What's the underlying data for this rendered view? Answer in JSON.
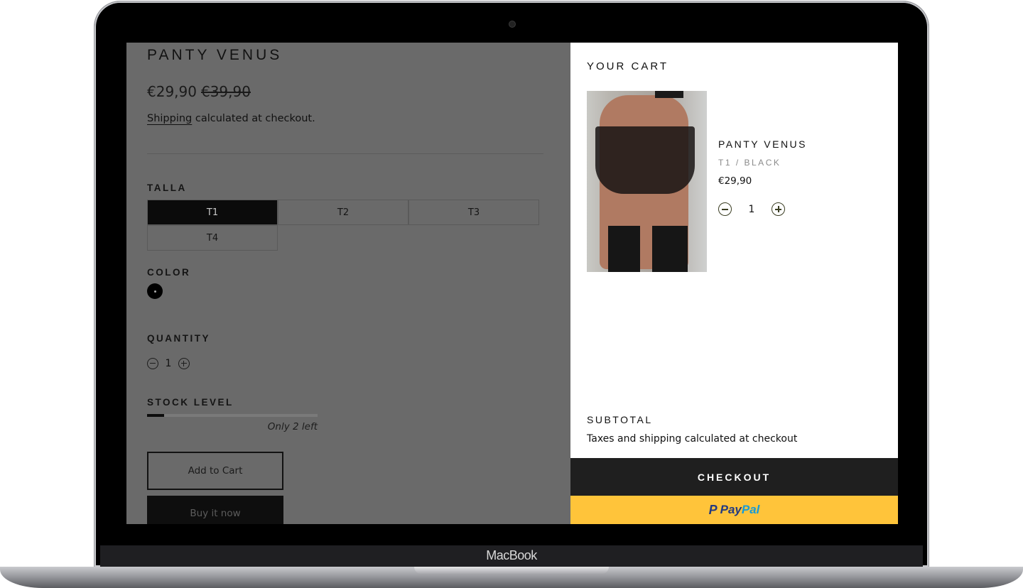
{
  "device": {
    "label": "MacBook"
  },
  "product": {
    "title": "PANTY VENUS",
    "price": "€29,90",
    "compare_price": "€39,90",
    "shipping_link": "Shipping",
    "shipping_text": " calculated at checkout.",
    "size_label": "TALLA",
    "sizes": [
      {
        "label": "T1",
        "selected": true
      },
      {
        "label": "T2",
        "selected": false
      },
      {
        "label": "T3",
        "selected": false
      },
      {
        "label": "T4",
        "selected": false
      }
    ],
    "color_label": "COLOR",
    "color_value": "#000000",
    "quantity_label": "QUANTITY",
    "quantity": "1",
    "stock_label": "STOCK LEVEL",
    "stock_fraction": 0.1,
    "stock_text": "Only 2 left",
    "add_to_cart": "Add to Cart",
    "buy_now": "Buy it now"
  },
  "cart": {
    "title": "YOUR CART",
    "item": {
      "name": "PANTY VENUS",
      "variant": "T1 / BLACK",
      "price": "€29,90",
      "quantity": "1"
    },
    "subtotal_label": "SUBTOTAL",
    "tax_note": "Taxes and shipping calculated at checkout",
    "checkout_label": "CHECKOUT",
    "paypal": {
      "part1": "Pay",
      "part2": "Pal"
    }
  },
  "colors": {
    "overlay": "#6a6a6a",
    "checkout_bg": "#1f1f1f",
    "paypal_bg": "#ffc43a"
  }
}
